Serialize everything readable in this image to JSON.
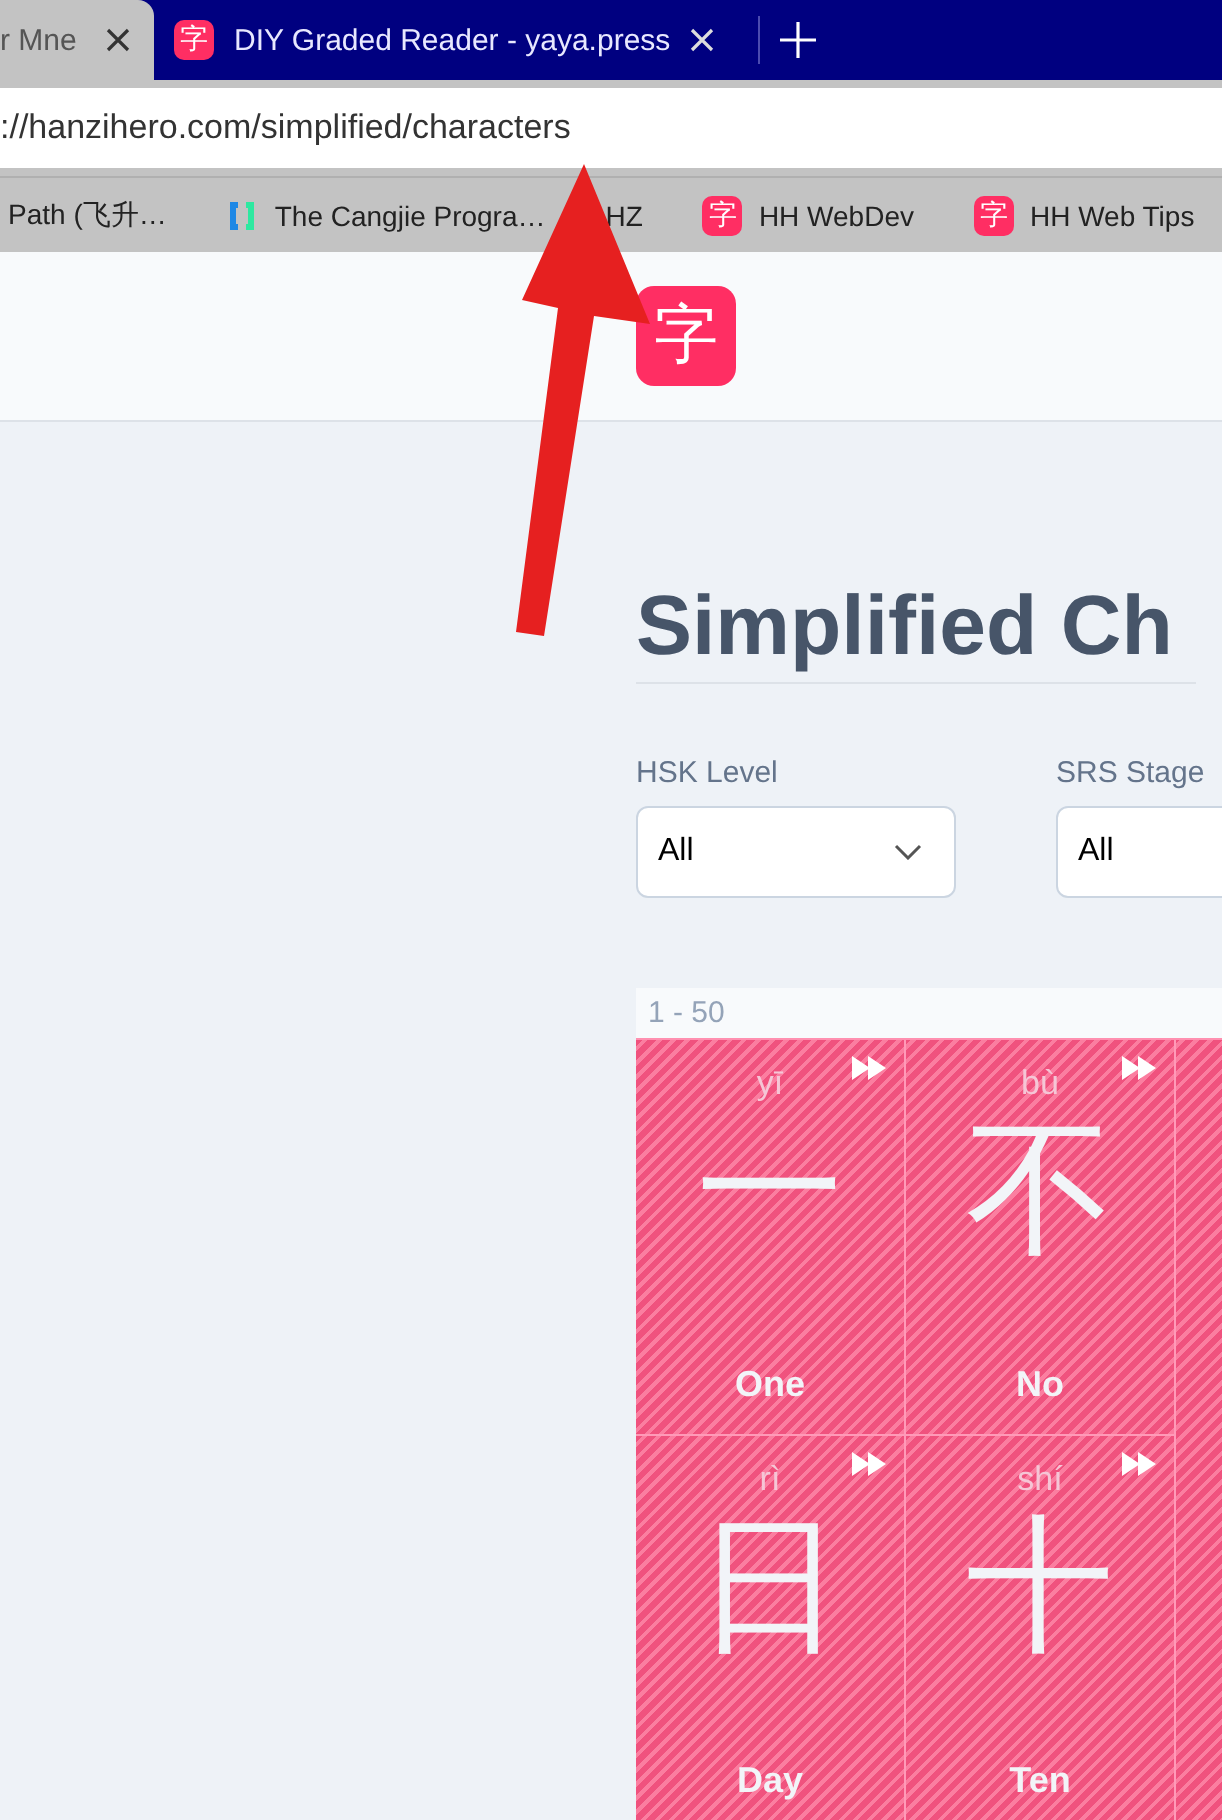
{
  "tabs": [
    {
      "title": "r Mne",
      "selected": true
    },
    {
      "title": "DIY Graded Reader - yaya.press",
      "selected": false,
      "favicon": "字"
    }
  ],
  "address_bar": {
    "url": "://hanzihero.com/simplified/characters"
  },
  "bookmarks": [
    {
      "label": "Path (飞升…",
      "kind": "none"
    },
    {
      "label": "The Cangjie Progra…",
      "kind": "brackets"
    },
    {
      "label": "HZ",
      "kind": "none"
    },
    {
      "label": "HH WebDev",
      "kind": "glyph",
      "favicon": "字"
    },
    {
      "label": "HH Web Tips",
      "kind": "glyph",
      "favicon": "字"
    }
  ],
  "header": {
    "logo": "字"
  },
  "page_title": "Simplified Ch",
  "filters": [
    {
      "label": "HSK Level",
      "value": "All",
      "chevron": true
    },
    {
      "label": "SRS Stage",
      "value": "All"
    }
  ],
  "grid": {
    "range": "1 - 50",
    "cards": [
      {
        "pinyin": "yī",
        "character": "一",
        "meaning": "One"
      },
      {
        "pinyin": "bù",
        "character": "不",
        "meaning": "No"
      },
      {
        "pinyin": "rì",
        "character": "日",
        "meaning": "Day"
      },
      {
        "pinyin": "shí",
        "character": "十",
        "meaning": "Ten"
      }
    ]
  }
}
